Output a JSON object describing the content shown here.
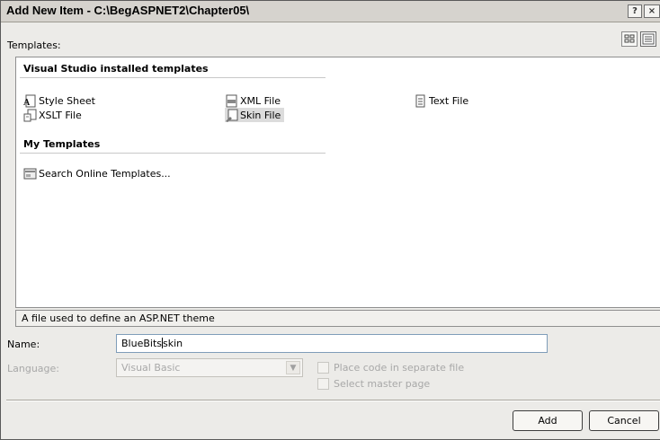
{
  "window": {
    "title": "Add New Item - C:\\BegASPNET2\\Chapter05\\",
    "help_glyph": "?",
    "close_glyph": "×"
  },
  "templates_label": "Templates:",
  "view_buttons": [
    {
      "name": "large-icons-view",
      "icon": "grid-icon"
    },
    {
      "name": "small-icons-view",
      "icon": "list-icon"
    }
  ],
  "groups": {
    "installed": {
      "header": "Visual Studio installed templates",
      "items": [
        {
          "label": "Style Sheet",
          "icon": "stylesheet-icon"
        },
        {
          "label": "XML File",
          "icon": "xml-file-icon"
        },
        {
          "label": "Text File",
          "icon": "text-file-icon"
        },
        {
          "label": "XSLT File",
          "icon": "xslt-file-icon"
        },
        {
          "label": "Skin File",
          "icon": "skin-file-icon",
          "selected": true
        }
      ]
    },
    "mine": {
      "header": "My Templates",
      "items": [
        {
          "label": "Search Online Templates...",
          "icon": "search-online-icon"
        }
      ]
    }
  },
  "description": "A file used to define an ASP.NET theme",
  "name_field": {
    "label": "Name:",
    "value_before_caret": "BlueBits",
    "value_after_caret": "skin"
  },
  "language_field": {
    "label": "Language:",
    "value": "Visual Basic",
    "enabled": false
  },
  "options": {
    "separate_code": "Place code in separate file",
    "master_page": "Select master page"
  },
  "buttons": {
    "add": "Add",
    "cancel": "Cancel"
  },
  "colors": {
    "dialog_bg": "#ecebe8",
    "selection_bg": "#dcdcdc",
    "disabled_text": "#a8a8a8"
  }
}
